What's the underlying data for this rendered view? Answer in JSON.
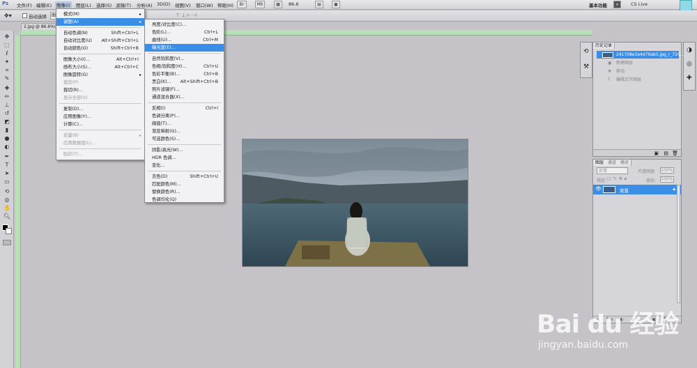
{
  "menubar": {
    "logo": "Ps",
    "items": [
      "文件(F)",
      "编辑(E)",
      "图像(I)",
      "图层(L)",
      "选择(S)",
      "滤镜(T)",
      "分析(A)",
      "3D(D)",
      "视图(V)",
      "窗口(W)",
      "帮助(H)"
    ],
    "zoom": "86.6",
    "workspace": "基本功能",
    "cs_live": "CS Live"
  },
  "optbar": {
    "auto_select": "自动选择",
    "auto_select_value": "图"
  },
  "document": {
    "tab_title": "2.jpg @ 86.6%(RGB"
  },
  "image_menu": {
    "items": [
      {
        "label": "模式(M)",
        "submenu": true
      },
      {
        "label": "调整(A)",
        "submenu": true,
        "highlight": true
      },
      {
        "label": "自动色调(N)",
        "shortcut": "Shift+Ctrl+L"
      },
      {
        "label": "自动对比度(U)",
        "shortcut": "Alt+Shift+Ctrl+L"
      },
      {
        "label": "自动颜色(O)",
        "shortcut": "Shift+Ctrl+B"
      },
      {
        "label": "图像大小(I)...",
        "shortcut": "Alt+Ctrl+I"
      },
      {
        "label": "画布大小(S)...",
        "shortcut": "Alt+Ctrl+C"
      },
      {
        "label": "图像旋转(G)",
        "submenu": true
      },
      {
        "label": "裁剪(P)",
        "disabled": true
      },
      {
        "label": "裁切(R)..."
      },
      {
        "label": "显示全部(V)",
        "disabled": true
      },
      {
        "label": "复制(D)..."
      },
      {
        "label": "应用图像(Y)..."
      },
      {
        "label": "计算(C)..."
      },
      {
        "label": "变量(B)",
        "submenu": true,
        "disabled": true
      },
      {
        "label": "应用数据组(L)...",
        "disabled": true
      },
      {
        "label": "陷印(T)...",
        "disabled": true
      }
    ]
  },
  "adjust_menu": {
    "items": [
      {
        "label": "亮度/对比度(C)..."
      },
      {
        "label": "色阶(L)...",
        "shortcut": "Ctrl+L"
      },
      {
        "label": "曲线(U)...",
        "shortcut": "Ctrl+M"
      },
      {
        "label": "曝光度(E)...",
        "highlight": true
      },
      {
        "label": "自然饱和度(V)..."
      },
      {
        "label": "色相/饱和度(H)...",
        "shortcut": "Ctrl+U"
      },
      {
        "label": "色彩平衡(B)...",
        "shortcut": "Ctrl+B"
      },
      {
        "label": "黑白(K)...",
        "shortcut": "Alt+Shift+Ctrl+B"
      },
      {
        "label": "照片滤镜(F)..."
      },
      {
        "label": "通道混合器(X)..."
      },
      {
        "label": "反相(I)",
        "shortcut": "Ctrl+I"
      },
      {
        "label": "色调分离(P)..."
      },
      {
        "label": "阈值(T)..."
      },
      {
        "label": "渐变映射(G)..."
      },
      {
        "label": "可选颜色(S)..."
      },
      {
        "label": "阴影/高光(W)..."
      },
      {
        "label": "HDR 色调..."
      },
      {
        "label": "变化..."
      },
      {
        "label": "去色(D)",
        "shortcut": "Shift+Ctrl+U"
      },
      {
        "label": "匹配颜色(M)..."
      },
      {
        "label": "替换颜色(R)..."
      },
      {
        "label": "色调均化(Q)"
      }
    ]
  },
  "history_panel": {
    "tab": "历史记录",
    "snapshot": "241708e3a4d79ab5.jpg_r_720...",
    "rows": [
      "新建图层",
      "移动",
      "编辑文字图层"
    ]
  },
  "layers_panel": {
    "tabs": [
      "图层",
      "通道",
      "路径"
    ],
    "blend_mode": "正常",
    "opacity_label": "不透明度:",
    "opacity": "100%",
    "lock_label": "锁定:",
    "fill_label": "填充:",
    "fill": "100%",
    "layer_name": "背景"
  },
  "watermark": {
    "brand": "Bai du 经验",
    "url": "jingyan.baidu.com"
  },
  "colors": {
    "highlight": "#3a8ee6",
    "ruler": "#b9dfb8",
    "canvas": "#c5c3c8"
  }
}
